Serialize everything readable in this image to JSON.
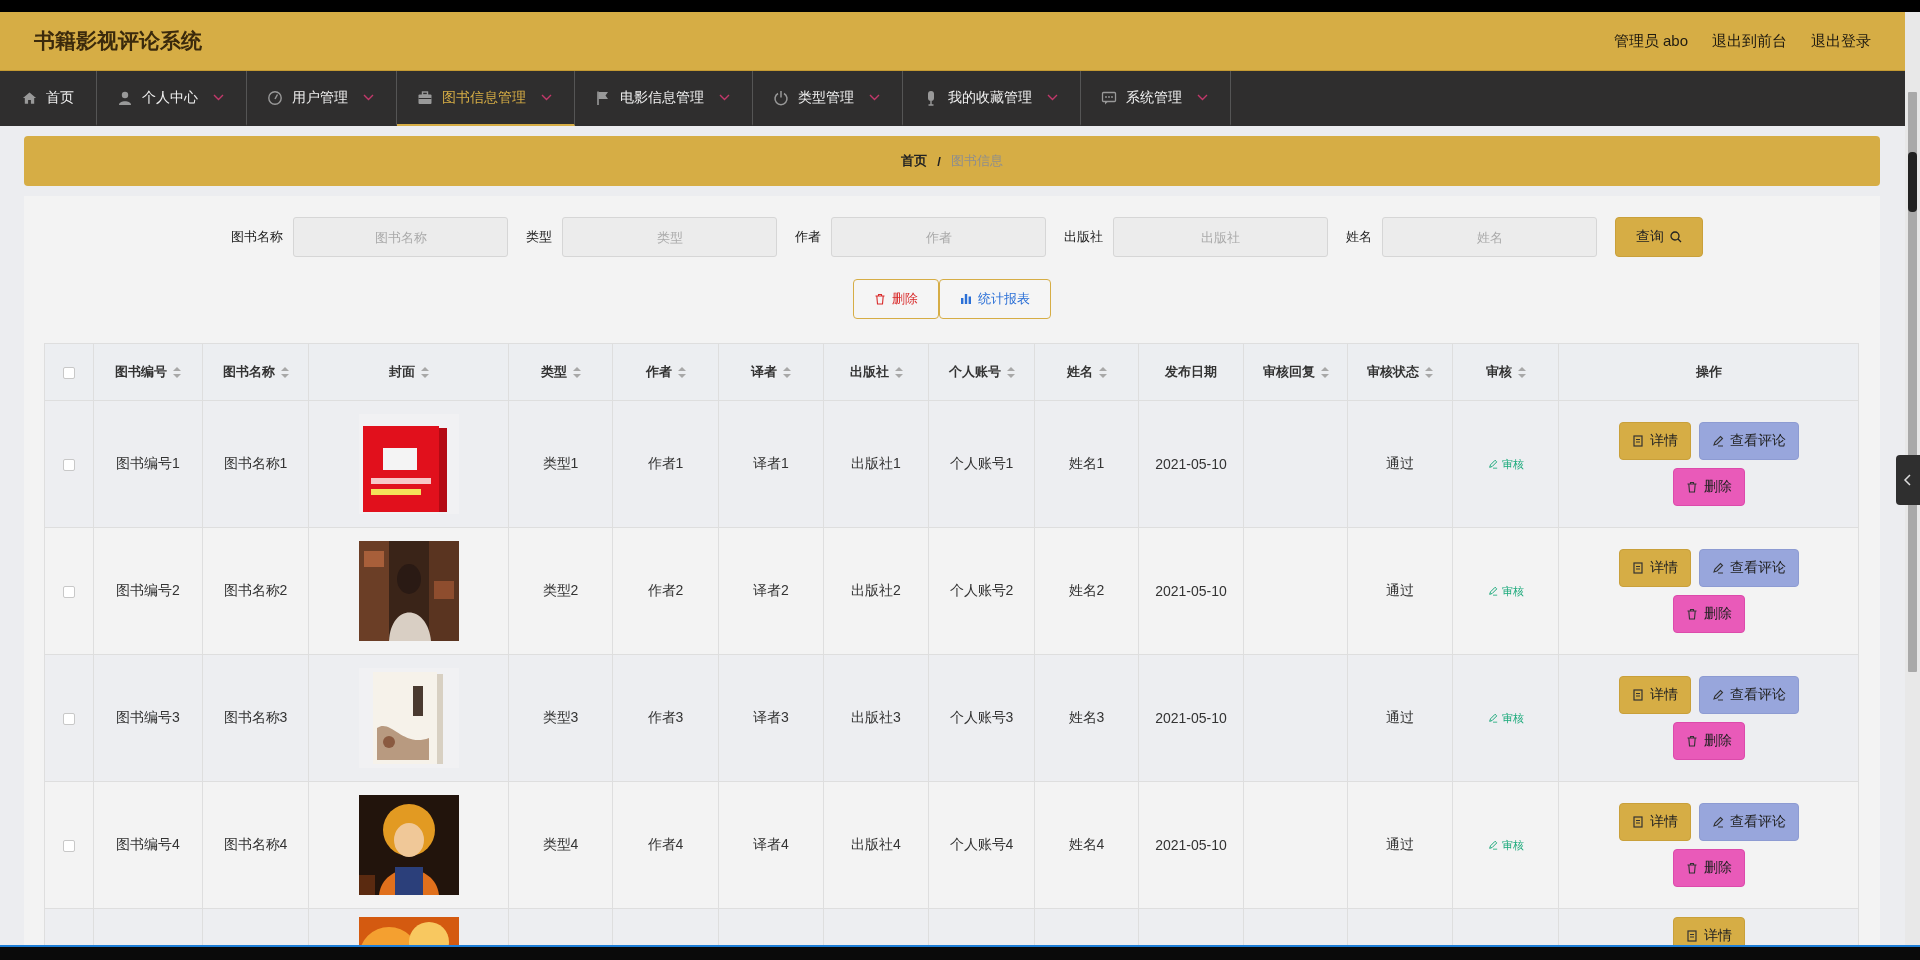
{
  "header": {
    "title": "书籍影视评论系统",
    "user": "管理员 abo",
    "links": [
      "退出到前台",
      "退出登录"
    ]
  },
  "nav": [
    {
      "label": "首页",
      "selected": false,
      "dropdown": false
    },
    {
      "label": "个人中心",
      "selected": false,
      "dropdown": true
    },
    {
      "label": "用户管理",
      "selected": false,
      "dropdown": true
    },
    {
      "label": "图书信息管理",
      "selected": true,
      "dropdown": true
    },
    {
      "label": "电影信息管理",
      "selected": false,
      "dropdown": true
    },
    {
      "label": "类型管理",
      "selected": false,
      "dropdown": true
    },
    {
      "label": "我的收藏管理",
      "selected": false,
      "dropdown": true
    },
    {
      "label": "系统管理",
      "selected": false,
      "dropdown": true
    }
  ],
  "breadcrumb": {
    "home": "首页",
    "separator": "/",
    "current": "图书信息"
  },
  "search": {
    "fields": [
      {
        "label": "图书名称",
        "placeholder": "图书名称"
      },
      {
        "label": "类型",
        "placeholder": "类型"
      },
      {
        "label": "作者",
        "placeholder": "作者"
      },
      {
        "label": "出版社",
        "placeholder": "出版社"
      },
      {
        "label": "姓名",
        "placeholder": "姓名"
      }
    ],
    "button": "查询"
  },
  "actions": [
    {
      "kind": "delete",
      "label": "删除"
    },
    {
      "kind": "report",
      "label": "统计报表"
    }
  ],
  "table": {
    "select_all": {
      "checked": false
    },
    "columns": [
      {
        "label": "图书编号",
        "sortable": true
      },
      {
        "label": "图书名称",
        "sortable": true
      },
      {
        "label": "封面",
        "sortable": true
      },
      {
        "label": "类型",
        "sortable": true
      },
      {
        "label": "作者",
        "sortable": true
      },
      {
        "label": "译者",
        "sortable": true
      },
      {
        "label": "出版社",
        "sortable": true
      },
      {
        "label": "个人账号",
        "sortable": true
      },
      {
        "label": "姓名",
        "sortable": true
      },
      {
        "label": "发布日期",
        "sortable": false
      },
      {
        "label": "审核回复",
        "sortable": true
      },
      {
        "label": "审核状态",
        "sortable": true
      },
      {
        "label": "审核",
        "sortable": true
      },
      {
        "label": "操作",
        "sortable": false
      }
    ],
    "rows": [
      {
        "checked": false,
        "cells": [
          "图书编号1",
          "图书名称1",
          null,
          "类型1",
          "作者1",
          "译者1",
          "出版社1",
          "个人账号1",
          "姓名1",
          "2021-05-10",
          "",
          "通过"
        ],
        "cover": {
          "kind": "picture"
        },
        "review": "审核",
        "buttons": [
          {
            "kind": "detail",
            "label": "详情"
          },
          {
            "kind": "comments",
            "label": "查看评论"
          },
          {
            "kind": "delete",
            "label": "删除"
          }
        ]
      },
      {
        "checked": false,
        "cells": [
          "图书编号2",
          "图书名称2",
          null,
          "类型2",
          "作者2",
          "译者2",
          "出版社2",
          "个人账号2",
          "姓名2",
          "2021-05-10",
          "",
          "通过"
        ],
        "cover": {
          "kind": "picture"
        },
        "review": "审核",
        "buttons": [
          {
            "kind": "detail",
            "label": "详情"
          },
          {
            "kind": "comments",
            "label": "查看评论"
          },
          {
            "kind": "delete",
            "label": "删除"
          }
        ]
      },
      {
        "checked": false,
        "cells": [
          "图书编号3",
          "图书名称3",
          null,
          "类型3",
          "作者3",
          "译者3",
          "出版社3",
          "个人账号3",
          "姓名3",
          "2021-05-10",
          "",
          "通过"
        ],
        "cover": {
          "kind": "picture"
        },
        "review": "审核",
        "buttons": [
          {
            "kind": "detail",
            "label": "详情"
          },
          {
            "kind": "comments",
            "label": "查看评论"
          },
          {
            "kind": "delete",
            "label": "删除"
          }
        ]
      },
      {
        "checked": false,
        "cells": [
          "图书编号4",
          "图书名称4",
          null,
          "类型4",
          "作者4",
          "译者4",
          "出版社4",
          "个人账号4",
          "姓名4",
          "2021-05-10",
          "",
          "通过"
        ],
        "cover": {
          "kind": "picture"
        },
        "review": "审核",
        "buttons": [
          {
            "kind": "detail",
            "label": "详情"
          },
          {
            "kind": "comments",
            "label": "查看评论"
          },
          {
            "kind": "delete",
            "label": "删除"
          }
        ]
      },
      {
        "cover": {
          "kind": "picture"
        },
        "buttons": [
          {
            "kind": "detail",
            "label": "详情"
          }
        ]
      }
    ]
  }
}
